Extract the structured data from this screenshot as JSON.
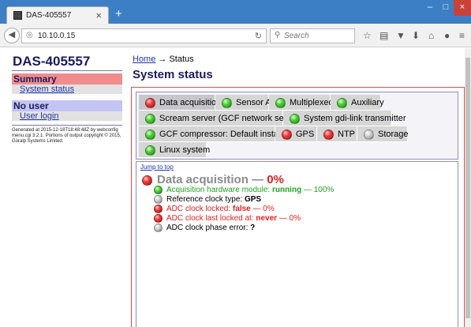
{
  "browser": {
    "tab_title": "DAS-405557",
    "tab_close": "×",
    "new_tab": "+",
    "url": "10.10.0.15",
    "search_placeholder": "Search",
    "win_min": "–",
    "win_max": "□",
    "win_close": "×"
  },
  "sidebar": {
    "title": "DAS-405557",
    "summary_header": "Summary",
    "summary_link": "System status",
    "user_header": "No user",
    "user_link": "User login",
    "footer": "Generated at 2015-12-18T18:48:48Z by webconfig menu.cgi 3.2.1. Portions of output copyright © 2015, Güralp Systems Limited."
  },
  "breadcrumb": {
    "home": "Home",
    "arrow": "→",
    "current": "Status"
  },
  "page_title": "System status",
  "status_tabs": [
    {
      "label": "Data acquisition",
      "status": "red"
    },
    {
      "label": "Sensor A",
      "status": "green"
    },
    {
      "label": "Multiplexed",
      "status": "green"
    },
    {
      "label": "Auxiliary",
      "status": "green"
    },
    {
      "label": "Scream server (GCF network sender)",
      "status": "green"
    },
    {
      "label": "System gdi-link transmitter",
      "status": "green"
    },
    {
      "label": "GCF compressor: Default instance",
      "status": "green"
    },
    {
      "label": "GPS",
      "status": "red"
    },
    {
      "label": "NTP",
      "status": "red"
    },
    {
      "label": "Storage",
      "status": "grey"
    },
    {
      "label": "Linux system",
      "status": "green"
    }
  ],
  "detail": {
    "jump_to_top": "Jump to top",
    "title": "Data acquisition",
    "dash": "—",
    "percent": "0%",
    "lines": [
      {
        "status": "green",
        "label": "Acquisition hardware module:",
        "value": "running",
        "suffix": "— 100%"
      },
      {
        "status": "grey",
        "label": "Reference clock type:",
        "value": "GPS",
        "suffix": ""
      },
      {
        "status": "red",
        "label": "ADC clock locked:",
        "value": "false",
        "suffix": "— 0%"
      },
      {
        "status": "red",
        "label": "ADC clock last locked at:",
        "value": "never",
        "suffix": "— 0%"
      },
      {
        "status": "grey",
        "label": "ADC clock phase error:",
        "value": "?",
        "suffix": ""
      }
    ]
  },
  "colors": {
    "accent_red": "#e21f1f",
    "ok_green": "#1fa51f",
    "heading_navy": "#1b1b5e",
    "link_blue": "#1e35b0"
  },
  "icons": {
    "back": "back-arrow-icon",
    "globe": "globe-icon",
    "reload": "reload-icon",
    "search": "search-icon",
    "star": "star-icon",
    "reading": "reading-list-icon",
    "pocket": "pocket-icon",
    "download": "download-icon",
    "home": "home-icon",
    "chat": "chat-icon",
    "menu": "menu-icon"
  }
}
